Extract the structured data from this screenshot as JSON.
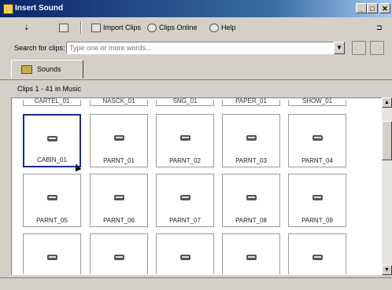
{
  "window": {
    "title": "Insert Sound",
    "min_icon": "minimize-icon",
    "max_icon": "maximize-icon",
    "close_icon": "close-icon"
  },
  "toolbar": {
    "import_clips": "Import Clips",
    "clips_online": "Clips Online",
    "help": "Help"
  },
  "search": {
    "label": "Search for clips:",
    "placeholder": "Type one or more words..."
  },
  "tabs": [
    {
      "label": "Sounds",
      "icon": "sounds-icon"
    }
  ],
  "clips_caption": "Clips 1 - 41 in Music",
  "grid": {
    "top_row_labels": [
      "CARTEL_01",
      "NASCK_01",
      "SNG_01",
      "PAPER_01",
      "SHOW_01"
    ],
    "rows": [
      [
        "CABIN_01",
        "PARNT_01",
        "PARNT_02",
        "PARNT_03",
        "PARNT_04"
      ],
      [
        "PARNT_05",
        "PARNT_06",
        "PARNT_07",
        "PARNT_08",
        "PARNT_09"
      ],
      [
        "",
        "",
        "",
        "",
        ""
      ]
    ],
    "selected": "CABIN_01"
  },
  "colors": {
    "title_bar": "#0a246a",
    "selection": "#1a2a8c",
    "face": "#d4d0c8"
  }
}
